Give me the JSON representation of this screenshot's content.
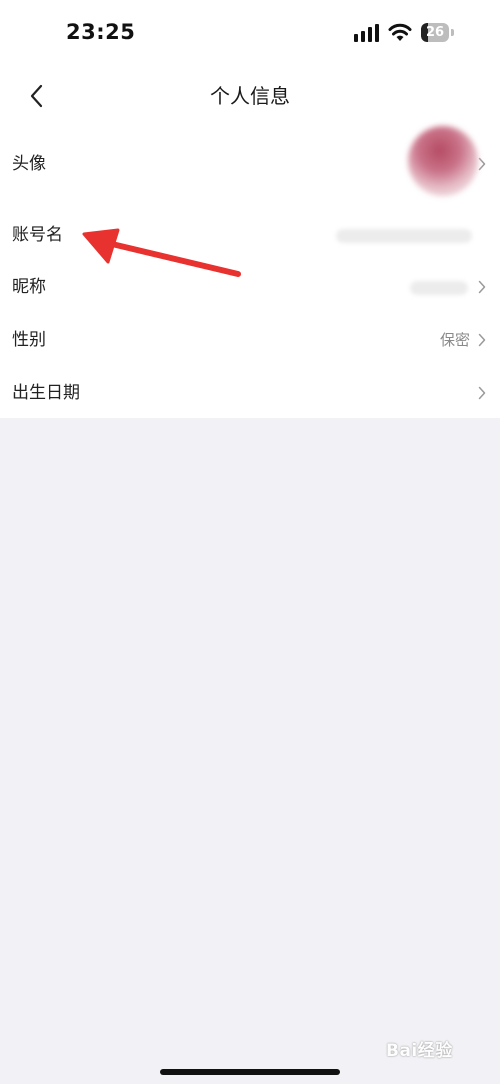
{
  "status_bar": {
    "time": "23:25",
    "battery_level": "26",
    "battery_fraction": 0.26
  },
  "nav": {
    "title": "个人信息",
    "back_icon": "chevron-left-icon"
  },
  "rows": [
    {
      "label": "头像",
      "value": ""
    },
    {
      "label": "账号名",
      "value": ""
    },
    {
      "label": "昵称",
      "value": ""
    },
    {
      "label": "性别",
      "value": "保密"
    },
    {
      "label": "出生日期",
      "value": ""
    }
  ],
  "annotation": {
    "color": "#e8322f",
    "icon": "red-arrow-icon"
  },
  "watermark": {
    "text": "Bai经验"
  },
  "colors": {
    "background": "#f2f2f6",
    "card": "#ffffff",
    "value_text": "#8a8a8a"
  }
}
